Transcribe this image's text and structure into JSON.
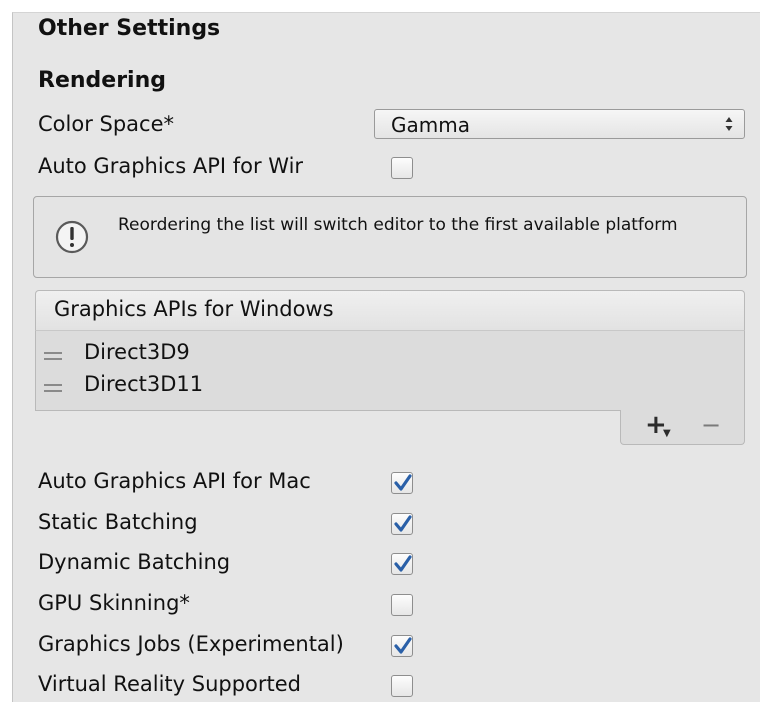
{
  "section_title": "Other Settings",
  "subsection_title": "Rendering",
  "color_space": {
    "label": "Color Space*",
    "value": "Gamma",
    "arrow": "↕"
  },
  "auto_api_windows": {
    "label": "Auto Graphics API for Wir",
    "checked": false
  },
  "help": {
    "icon": "exclamation-icon",
    "text": "Reordering the list will switch editor to the first available platform"
  },
  "graphics_list": {
    "header": "Graphics APIs for Windows",
    "items": [
      "Direct3D9",
      "Direct3D11"
    ],
    "add_label": "+",
    "remove_label": "−"
  },
  "options": [
    {
      "label": "Auto Graphics API for Mac",
      "checked": true
    },
    {
      "label": "Static Batching",
      "checked": true
    },
    {
      "label": "Dynamic Batching",
      "checked": true
    },
    {
      "label": "GPU Skinning*",
      "checked": false
    },
    {
      "label": "Graphics Jobs (Experimental)",
      "checked": true
    },
    {
      "label": "Virtual Reality Supported",
      "checked": false
    }
  ],
  "colors": {
    "panel": "#e6e6e6",
    "check": "#2a60a8"
  }
}
